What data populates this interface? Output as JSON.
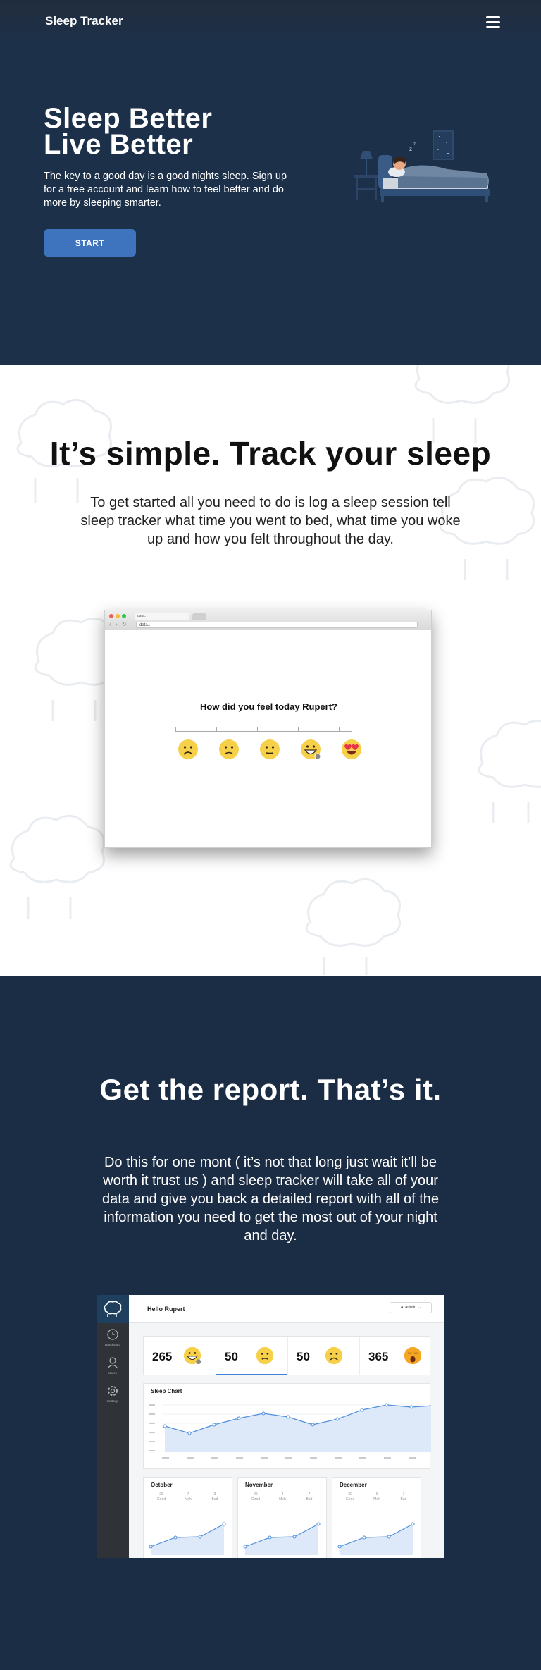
{
  "nav": {
    "brand": "Sleep Tracker",
    "menu_icon": "hamburger-icon"
  },
  "hero": {
    "title_line1": "Sleep Better",
    "title_line2": "Live Better",
    "subtitle": "The key to a good day is a good nights sleep. Sign up for a free account and learn how to feel better and do more by sleeping smarter.",
    "cta_label": "START"
  },
  "simple": {
    "title": "It’s simple. Track your sleep",
    "text": "To get started all you need to do is log a sleep session tell sleep tracker what time you went to bed, what time you woke up and how you felt throughout the day.",
    "browser": {
      "tab_label": "data..",
      "url": "data..",
      "question": "How did you feel today Rupert?",
      "emoji_options": [
        "frowning-face",
        "slightly-frowning-face",
        "neutral-face",
        "grinning-face",
        "heart-eyes-face"
      ]
    }
  },
  "report": {
    "title": "Get the report. That’s it.",
    "text": "Do this for one mont ( it’s not that long just wait it’ll be worth it trust us ) and sleep tracker will take all of your data and give you back a detailed report with all of the information you need to get the most out of your night and day.",
    "dashboard": {
      "greeting": "Hello Rupert",
      "user_menu": "admin",
      "sidebar": [
        {
          "label": "Dashboard",
          "icon": "clock-icon"
        },
        {
          "label": "Users",
          "icon": "user-icon"
        },
        {
          "label": "Settings",
          "icon": "gear-icon"
        }
      ],
      "stats": [
        {
          "value": "265",
          "face": "grinning-face"
        },
        {
          "value": "50",
          "face": "slightly-frowning-face"
        },
        {
          "value": "50",
          "face": "frowning-face"
        },
        {
          "value": "365",
          "face": "sleepy-face"
        }
      ],
      "chart_title": "Sleep Chart",
      "months": [
        {
          "name": "October",
          "figures": [
            "28",
            "7",
            "3"
          ],
          "labels": [
            "Good",
            "Meh",
            "Bad"
          ]
        },
        {
          "name": "November",
          "figures": [
            "26",
            "4",
            "7"
          ],
          "labels": [
            "Good",
            "Meh",
            "Bad"
          ]
        },
        {
          "name": "December",
          "figures": [
            "30",
            "6",
            "1"
          ],
          "labels": [
            "Good",
            "Meh",
            "Bad"
          ]
        }
      ]
    }
  },
  "colors": {
    "hero_bg": "#1c304a",
    "report_bg": "#1b2c45",
    "accent": "#3e74bd",
    "emoji_yellow": "#f7d04a"
  }
}
